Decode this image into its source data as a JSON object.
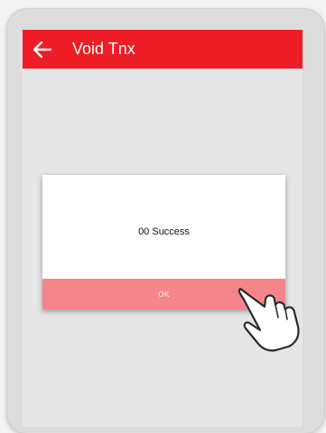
{
  "app_bar": {
    "title": "Void Tnx",
    "back_icon": "arrow-left-icon",
    "color": "#ee1c25"
  },
  "dialog": {
    "message": "00 Success",
    "ok_label": "OK",
    "ok_color": "#f5858b"
  },
  "overlay": {
    "pointer_icon": "hand-pointer-icon"
  }
}
